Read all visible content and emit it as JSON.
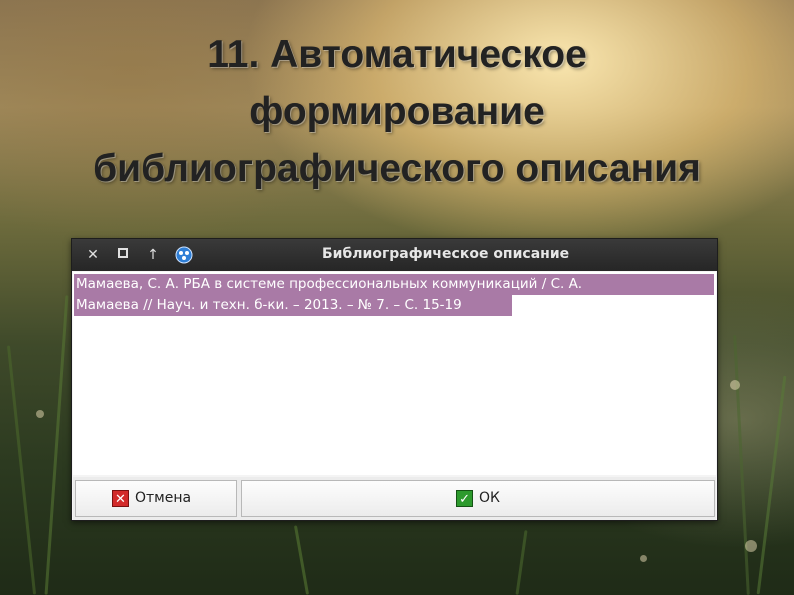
{
  "slide": {
    "title_lines": [
      "11. Автоматическое",
      "формирование",
      "библиографического описания"
    ]
  },
  "dialog": {
    "title": "Библиографическое описание",
    "titlebar_icons": [
      "close-icon",
      "maximize-icon",
      "up-arrow-icon",
      "app-icon"
    ],
    "text_lines": [
      "Мамаева, С. А. РБА в системе профессиональных коммуникаций / С. А.",
      "Мамаева // Науч. и техн. б-ки. – 2013. – № 7. – С. 15-19"
    ],
    "cancel_label": "Отмена",
    "ok_label": "ОК"
  },
  "colors": {
    "selection": "#a97aa6",
    "titlebar": "#2e2e2e",
    "cancel_icon": "#d22a2a",
    "ok_icon": "#2d9a2d"
  }
}
